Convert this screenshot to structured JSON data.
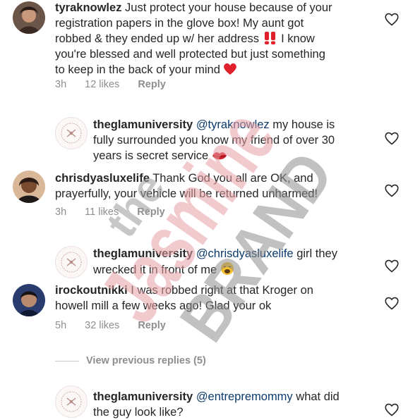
{
  "comments": [
    {
      "username": "tyraknowlez",
      "lines": [
        " Just protect your house because of your",
        "registration papers in the glove box! My aunt got",
        "robbed & they ended up w/ her address ",
        "you're blessed and well protected but just something",
        "to keep in the back of your mind "
      ],
      "line3_tail": " I know",
      "time": "3h",
      "likes": "12 likes",
      "reply": "Reply",
      "avatar_icon": "profile-photo"
    },
    {
      "username": "theglamuniversity",
      "mention": "@tyraknowlez",
      "lines": [
        " my house is",
        "fully surrounded you know my friend of over 30",
        "years is secret service "
      ],
      "avatar_icon": "brand-logo"
    },
    {
      "username": "chrisdyasluxelife",
      "lines": [
        " Thank God you all are OK, and",
        "prayerfully, your vehicle will be returned unharmed!"
      ],
      "time": "3h",
      "likes": "11 likes",
      "reply": "Reply",
      "avatar_icon": "profile-photo"
    },
    {
      "username": "theglamuniversity",
      "mention": "@chrisdyasluxelife",
      "lines": [
        " girl they",
        "wrecked it in front of me "
      ],
      "avatar_icon": "brand-logo"
    },
    {
      "username": "irockoutnikki",
      "lines": [
        " I was robbed right at that Kroger on",
        "howell mill a few weeks ago! Glad your ok"
      ],
      "time": "5h",
      "likes": "32 likes",
      "reply": "Reply",
      "avatar_icon": "profile-photo"
    },
    {
      "username": "theglamuniversity",
      "mention": "@entrepremommy",
      "lines": [
        " what did",
        "the guy look like?"
      ],
      "avatar_icon": "brand-logo"
    }
  ],
  "view_previous": "View previous replies (5)",
  "watermark": {
    "line1": "the",
    "line2": "Jasmine",
    "line3": "BRAND"
  },
  "icons": {
    "like": "heart-outline-icon",
    "double_exclamation": "double-exclamation-emoji",
    "red_heart": "red-heart-emoji",
    "kiss": "lips-emoji",
    "tired_face": "weary-face-emoji"
  },
  "colors": {
    "text": "#262626",
    "meta": "#8e8e8e",
    "mention": "#0c3a6b",
    "watermark_pink": "#e9a3a9",
    "watermark_gray": "#8a8a8a"
  }
}
